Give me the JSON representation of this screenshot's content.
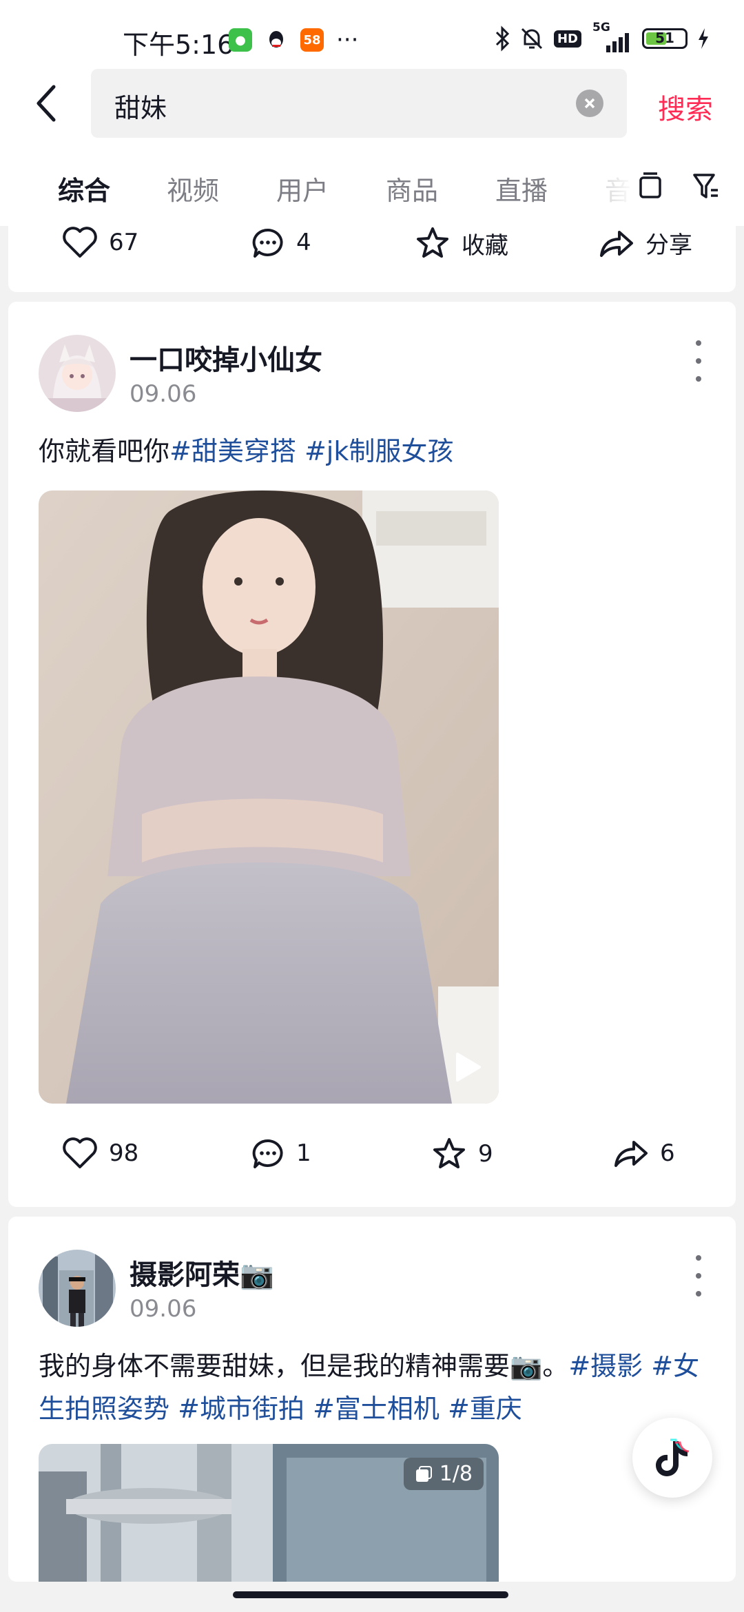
{
  "status_bar": {
    "time": "下午5:16",
    "app_58_label": "58",
    "more": "···",
    "network": "5G",
    "hd": "HD",
    "battery_level": "51"
  },
  "search": {
    "query": "甜妹",
    "submit_label": "搜索"
  },
  "tabs": [
    {
      "label": "综合",
      "active": true
    },
    {
      "label": "视频",
      "active": false
    },
    {
      "label": "用户",
      "active": false
    },
    {
      "label": "商品",
      "active": false
    },
    {
      "label": "直播",
      "active": false
    },
    {
      "label": "音",
      "active": false
    }
  ],
  "prev_card": {
    "likes": "67",
    "comments": "4",
    "favorite_label": "收藏",
    "share_label": "分享"
  },
  "posts": [
    {
      "author": "一口咬掉小仙女",
      "date": "09.06",
      "caption_text": "你就看吧你",
      "hashtags": [
        "#甜美穿搭",
        "#jk制服女孩"
      ],
      "media_type": "video",
      "likes": "98",
      "comments": "1",
      "favorites": "9",
      "shares": "6"
    },
    {
      "author": "摄影阿荣📷",
      "date": "09.06",
      "caption_text": "我的身体不需要甜妹，但是我的精神需要📷。",
      "hashtags": [
        "#摄影",
        "#女生拍照姿势",
        "#城市街拍",
        "#富士相机",
        "#重庆"
      ],
      "media_type": "image",
      "page_indicator": "1/8"
    }
  ],
  "colors": {
    "accent": "#fe2c55",
    "hashtag": "#1f4e9b",
    "text": "#161823",
    "muted": "#8a8b91"
  }
}
